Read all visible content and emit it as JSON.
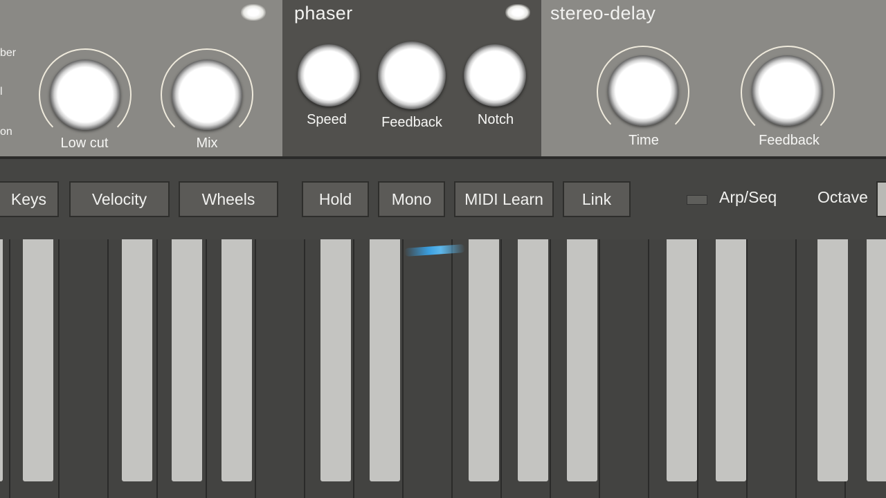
{
  "left_panel": {
    "side_labels": [
      "ber",
      "l",
      "on"
    ],
    "knobs": [
      {
        "label": "Low cut"
      },
      {
        "label": "Mix"
      }
    ]
  },
  "phaser": {
    "title": "phaser",
    "knobs": [
      {
        "label": "Speed"
      },
      {
        "label": "Feedback"
      },
      {
        "label": "Notch"
      }
    ]
  },
  "stereo_delay": {
    "title": "stereo-delay",
    "knobs": [
      {
        "label": "Time"
      },
      {
        "label": "Feedback"
      }
    ]
  },
  "toolbar": {
    "buttons": [
      {
        "label": "Keys"
      },
      {
        "label": "Velocity"
      },
      {
        "label": "Wheels"
      },
      {
        "label": "Hold"
      },
      {
        "label": "Mono"
      },
      {
        "label": "MIDI Learn"
      },
      {
        "label": "Link"
      }
    ],
    "arp_seq_label": "Arp/Seq",
    "octave_label": "Octave"
  },
  "colors": {
    "panel_light": "#8a8985",
    "panel_dark": "#51504d",
    "toolbar_bg": "#454543",
    "key_dark": "#434341",
    "key_light": "#c4c4c1",
    "accent_blue": "#39a8f0"
  }
}
